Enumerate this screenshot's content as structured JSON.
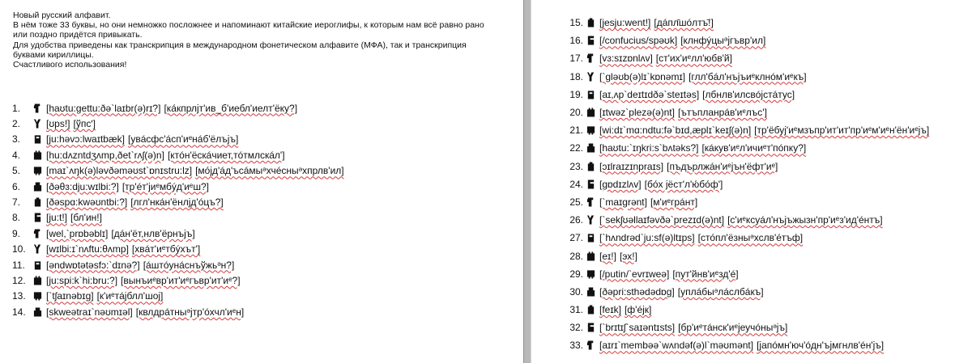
{
  "intro": {
    "line1": "Новый русский алфавит.",
    "line2": "В нём тоже 33 буквы, но они немножко посложнее и напоминают китайские иероглифы, к которым нам всё равно рано или поздно придётся привыкать.",
    "line3": "Для удобства приведены как транскрипция в международном фонетическом алфавите (МФА), так и транскрипция буквами кириллицы.",
    "line4": "Счастливого использования!"
  },
  "letters": [
    {
      "num": "1.",
      "glyph": "glyph-icon",
      "ipa": "[haʊtu:gettu:ðə`laɪbr(ə)rɪ?]",
      "tr": "[ка́кпрлјт'ив_б'иебл'иелт'ёку?]"
    },
    {
      "num": "2.",
      "glyph": "glyph-icon",
      "ipa": "[ʊps!]",
      "tr": "[ўпсʹ]"
    },
    {
      "num": "3.",
      "glyph": "glyph-icon",
      "ipa": "[ju:həvɔ:lwaɪtbæk]",
      "tr": "[увáсфс'áсп'иᵉнáб'ёлъјъ]"
    },
    {
      "num": "4.",
      "glyph": "glyph-icon",
      "ipa": "[hu:dʌzntdʒʌmp,ðet`rʌʃ(ə)n]",
      "tr": "[ктóн'ёскáчиет,тóтмлскáл']"
    },
    {
      "num": "5.",
      "glyph": "glyph-icon",
      "ipa": "[maɪ`ʌŋk(ə)ləvðəməʊst`ɒnɪstru:lz]",
      "tr": "[мо́јд'áд'ъсáмыᵊхчéсныᵊхпрлв'ил]"
    },
    {
      "num": "6.",
      "glyph": "glyph-icon",
      "ipa": "[ðəθɜ:dju:wɪlbi:?]",
      "tr": "[тр'éт'јиᵉмбýд'иᵉш?]"
    },
    {
      "num": "7.",
      "glyph": "glyph-icon",
      "ipa": "[ðəspɑ:kwəʊntbi:?]",
      "tr": "[лгл'нкáн'ёнлјд'óцъ?]"
    },
    {
      "num": "8.",
      "glyph": "glyph-icon",
      "ipa": "[ju:t!]",
      "tr": "[бл'ин!]"
    },
    {
      "num": "9.",
      "glyph": "glyph-icon",
      "ipa": "[wel,`prɒbəblɪ]",
      "tr": "[дáн'ёт,нлв'ёрнъјъ]"
    },
    {
      "num": "10.",
      "glyph": "glyph-icon",
      "ipa": "[wɪlbi:ɪ`nʌftu:θʌmp]",
      "tr": "[хвáт'иᵉтбýхът']"
    },
    {
      "num": "11.",
      "glyph": "glyph-icon",
      "ipa": "[əndwɒtətəsfɔ:`dɪnə?]",
      "tr": "[áштóунáснъўжьᵊн?]"
    },
    {
      "num": "12.",
      "glyph": "glyph-icon",
      "ipa": "[ju:spi:k`hi:bru:?]",
      "tr": "[вынъиᵉвр'ит'иᵉгъвр'ит'иᵉ?]"
    },
    {
      "num": "13.",
      "glyph": "glyph-icon",
      "ipa": "[`tʃaɪnəbɪg]",
      "tr": "[к'иᵉтáјблл'шој]"
    },
    {
      "num": "14.",
      "glyph": "glyph-icon",
      "ipa": "[skweətraɪ`nəʊmɪəl]",
      "tr": "[квлдрáтныᵊјтр'óхчл'иᵉн]"
    },
    {
      "num": "15.",
      "glyph": "glyph-icon",
      "ipa": "[jesju:went!]",
      "tr": "[дáпл̄шóлтъ̄!]"
    },
    {
      "num": "16.",
      "glyph": "glyph-icon",
      "ipa": "[/confucius/spəʊk]",
      "tr": "[клнфýцыᵊјгъвр'ил]"
    },
    {
      "num": "17.",
      "glyph": "glyph-icon",
      "ipa": "[vɜ:sɪzɒnlʌv]",
      "tr": "[ст'их'иᵉлл'юбв'й]"
    },
    {
      "num": "18.",
      "glyph": "glyph-icon",
      "ipa": "[`gləʊb(ə)lɪ`kɒnəmɪ]",
      "tr": "[глл'бáл'нъјъиᵉклнóм'иᵉкъ]"
    },
    {
      "num": "19.",
      "glyph": "glyph-icon",
      "ipa": "[aɪ,ʌp`deɪtɪdðə`steɪtəs]",
      "tr": "[лбнлв'илсвóјстáтус]"
    },
    {
      "num": "20.",
      "glyph": "glyph-icon",
      "ipa": "[ɪtwəz`plezə(ə)nt]",
      "tr": "[ътъпланрáв'иᵉлъс']"
    },
    {
      "num": "21.",
      "glyph": "glyph-icon",
      "ipa": "[wi:dɪ`mɑ:ndtu:fə`bɪd,æplɪ`keɪʃ(ə)n]",
      "tr": "[тр'ёбуј'иᵉмзъпр'ит'ит'пр'иᵉм'иᵉн'ён'иᵉјъ]"
    },
    {
      "num": "22.",
      "glyph": "glyph-icon",
      "ipa": "[haʊtu:`ɪŋkri:s`bʌtəks?]",
      "tr": "[кáкув'иᵉл'ичиᵉт'пóпку?]"
    },
    {
      "num": "23.",
      "glyph": "glyph-icon",
      "ipa": "[ɔɪlraɪzɪnpraɪs]",
      "tr": "[пъдърлжáн'иᵉјън'ёфт'иᵉ]"
    },
    {
      "num": "24.",
      "glyph": "glyph-icon",
      "ipa": "[gɒdɪzlʌv]",
      "tr": "[бо́х јёст'л'ю́бо́ф']"
    },
    {
      "num": "25.",
      "glyph": "glyph-icon",
      "ipa": "[`maɪgrənt]",
      "tr": "[м'иᵉгрáнт]"
    },
    {
      "num": "26.",
      "glyph": "glyph-icon",
      "ipa": "[`sekʃʊəllaɪfəvðə`prezɪd(ə)nt]",
      "tr": "[с'иᵉксуáл'нъјъжызн'пр'иᵉз'ид'éнтъ]"
    },
    {
      "num": "27.",
      "glyph": "glyph-icon",
      "ipa": "[`hʌndrəd`ju:sf(ə)ltɪps]",
      "tr": "[сто́пл'ёзныᵊхслв'éтъф]"
    },
    {
      "num": "28.",
      "glyph": "glyph-icon",
      "ipa": "[eɪ!]",
      "tr": "[эх!]"
    },
    {
      "num": "29.",
      "glyph": "glyph-icon",
      "ipa": "[/putin/`evrɪweə]",
      "tr": "[пут'йнв'иᵉзд'é]"
    },
    {
      "num": "30.",
      "glyph": "glyph-icon",
      "ipa": "[ðəpri:sthədədɒg]",
      "tr": "[уплáбыᵊлáслбáкъ]"
    },
    {
      "num": "31.",
      "glyph": "glyph-icon",
      "ipa": "[feɪk]",
      "tr": "[ф'éјк]"
    },
    {
      "num": "32.",
      "glyph": "glyph-icon",
      "ipa": "[`brɪtɪʃ`saɪəntɪsts]",
      "tr": "[бр'иᵉтáнск'иᵉјеучóныᵊјъ]"
    },
    {
      "num": "33.",
      "glyph": "glyph-icon",
      "ipa": "[aɪrɪ`membəə`wʌndəf(ə)l`məʊmənt]",
      "tr": "[јапóмн'юч'óдн'ъјмгнлв'éн'јъ]"
    }
  ]
}
